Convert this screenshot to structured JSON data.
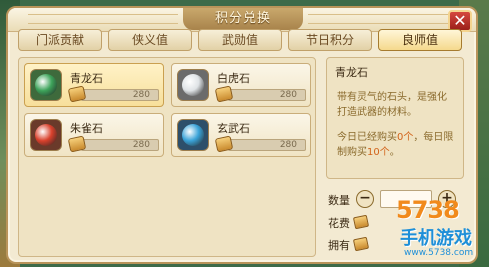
{
  "window": {
    "title": "积分兑换",
    "close_label": "✕"
  },
  "tabs": [
    {
      "label": "门派贡献",
      "active": false
    },
    {
      "label": "侠义值",
      "active": false
    },
    {
      "label": "武勋值",
      "active": false
    },
    {
      "label": "节日积分",
      "active": false
    },
    {
      "label": "良师值",
      "active": true
    }
  ],
  "items": [
    {
      "name": "青龙石",
      "price": "280",
      "selected": true,
      "gem_color": "#3da35a"
    },
    {
      "name": "白虎石",
      "price": "280",
      "selected": false,
      "gem_color": "#dfe3e6"
    },
    {
      "name": "朱雀石",
      "price": "280",
      "selected": false,
      "gem_color": "#d9412c"
    },
    {
      "name": "玄武石",
      "price": "280",
      "selected": false,
      "gem_color": "#3aa3d8"
    }
  ],
  "detail": {
    "name": "青龙石",
    "description": "带有灵气的石头，是强化打造武器的材料。",
    "limit_prefix": "今日已经购买",
    "bought_count": "0个",
    "limit_middle": "，每日限制购买",
    "limit_count": "10个",
    "limit_suffix": "。"
  },
  "purchase": {
    "quantity_label": "数量",
    "minus_label": "−",
    "plus_label": "+",
    "cost_label": "花费",
    "owned_label": "拥有"
  },
  "watermark": {
    "top": "5738",
    "bottom": "手机游戏",
    "sub": "www.5738.com"
  },
  "colors": {
    "accent": "#a8834b",
    "panel": "#f3ead2",
    "highlight": "#d2631a"
  }
}
